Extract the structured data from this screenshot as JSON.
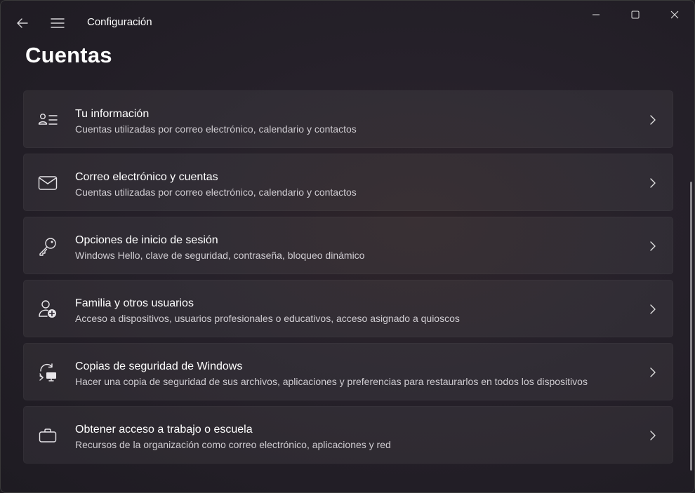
{
  "app": {
    "title": "Configuración"
  },
  "icons": {
    "back": "back-arrow-icon",
    "menu": "hamburger-menu-icon",
    "minimize": "minimize-icon",
    "maximize": "maximize-icon",
    "close": "close-icon"
  },
  "page": {
    "title": "Cuentas"
  },
  "items": [
    {
      "icon": "user-info-icon",
      "title": "Tu información",
      "description": "Cuentas utilizadas por correo electrónico, calendario y contactos"
    },
    {
      "icon": "mail-icon",
      "title": "Correo electrónico y cuentas",
      "description": "Cuentas utilizadas por correo electrónico, calendario y contactos"
    },
    {
      "icon": "key-icon",
      "title": "Opciones de inicio de sesión",
      "description": "Windows Hello, clave de seguridad, contraseña, bloqueo dinámico"
    },
    {
      "icon": "add-person-icon",
      "title": "Familia y otros usuarios",
      "description": "Acceso a dispositivos, usuarios profesionales o educativos, acceso asignado a quioscos"
    },
    {
      "icon": "backup-sync-icon",
      "title": "Copias de seguridad de Windows",
      "description": "Hacer una copia de seguridad de sus archivos, aplicaciones y preferencias para restaurarlos en todos los dispositivos"
    },
    {
      "icon": "briefcase-icon",
      "title": "Obtener acceso a trabajo o escuela",
      "description": "Recursos de la organización como correo electrónico, aplicaciones y red"
    }
  ],
  "colors": {
    "background": "#26212a",
    "card": "#35303a",
    "text_primary": "#ffffff",
    "text_secondary": "#d0cdd2"
  }
}
